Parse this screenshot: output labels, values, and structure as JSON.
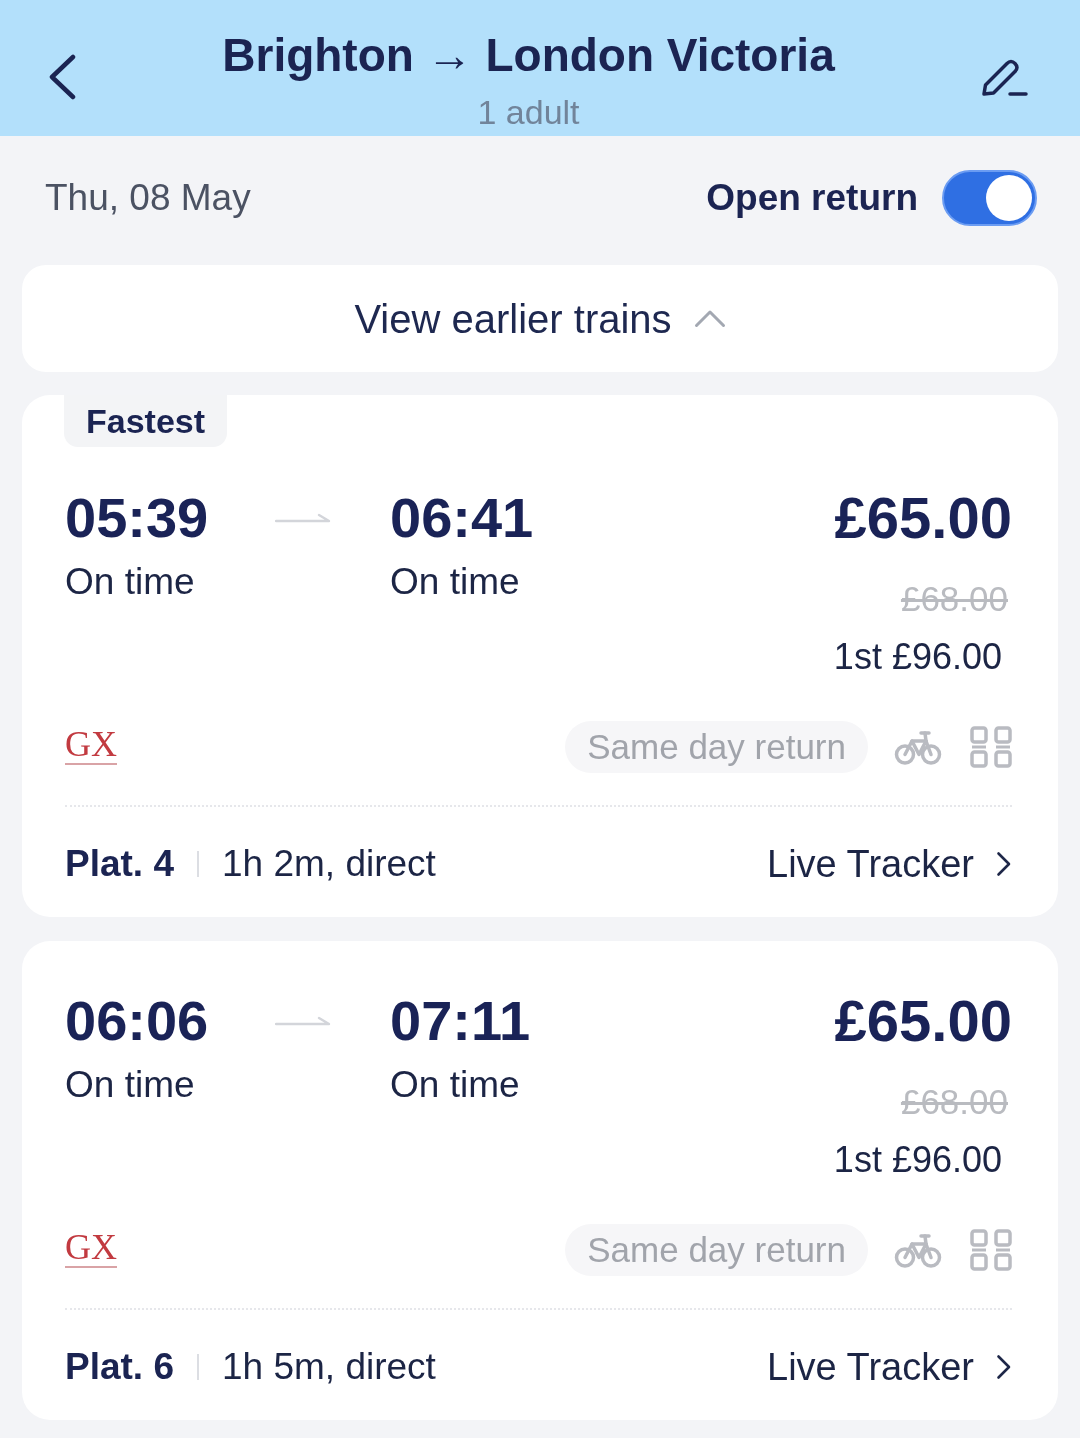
{
  "header": {
    "title": "Brighton → London Victoria",
    "subtitle": "1 adult"
  },
  "date_bar": {
    "date": "Thu, 08 May",
    "open_return": {
      "label": "Open return",
      "on": true
    }
  },
  "earlier_trains": {
    "label": "View earlier trains"
  },
  "journeys": [
    {
      "tag": "Fastest",
      "departure": {
        "time": "05:39",
        "status": "On time"
      },
      "arrival": {
        "time": "06:41",
        "status": "On time"
      },
      "price": "£65.00",
      "original_price": "£68.00",
      "first_class": "1st £96.00",
      "operator_logo": "GX",
      "fare_type": "Same day return",
      "platform": "Plat. 4",
      "duration": "1h 2m, direct",
      "tracker": "Live Tracker"
    },
    {
      "departure": {
        "time": "06:06",
        "status": "On time"
      },
      "arrival": {
        "time": "07:11",
        "status": "On time"
      },
      "price": "£65.00",
      "original_price": "£68.00",
      "first_class": "1st £96.00",
      "operator_logo": "GX",
      "fare_type": "Same day return",
      "platform": "Plat. 6",
      "duration": "1h 5m, direct",
      "tracker": "Live Tracker"
    }
  ]
}
